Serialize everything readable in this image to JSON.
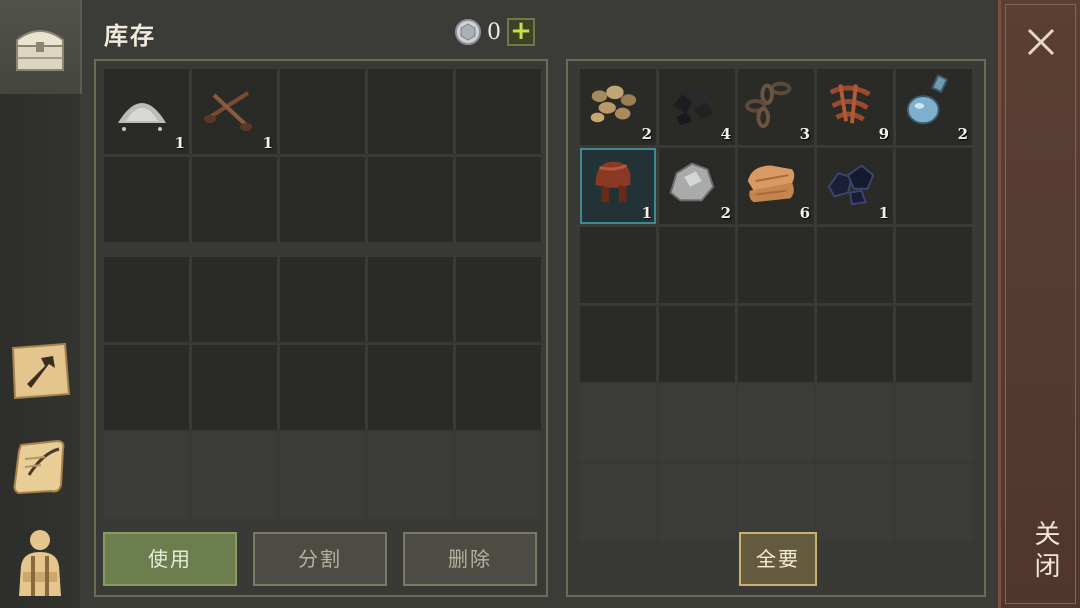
{
  "header": {
    "title": "库存",
    "currency_value": "0",
    "plus_label": "+"
  },
  "left_tabs": [
    {
      "name": "chest-icon",
      "active": true
    },
    {
      "name": "crafting-icon"
    },
    {
      "name": "scroll-icon"
    },
    {
      "name": "character-icon"
    }
  ],
  "inventory_top": {
    "items": [
      {
        "name": "stone-dust",
        "qty": "1"
      },
      {
        "name": "nails",
        "qty": "1"
      }
    ]
  },
  "storage": {
    "items": [
      {
        "name": "stones",
        "qty": "2"
      },
      {
        "name": "coal",
        "qty": "4"
      },
      {
        "name": "chain",
        "qty": "3"
      },
      {
        "name": "rusty-scrap",
        "qty": "9"
      },
      {
        "name": "glass-bottle",
        "qty": "2"
      },
      {
        "name": "saddle",
        "qty": "1"
      },
      {
        "name": "iron-ore",
        "qty": "2"
      },
      {
        "name": "leather",
        "qty": "6"
      },
      {
        "name": "dark-ore",
        "qty": "1"
      }
    ]
  },
  "buttons": {
    "use": "使用",
    "split": "分割",
    "delete": "删除",
    "take_all": "全要"
  },
  "close": {
    "label": "关闭"
  },
  "colors": {
    "accent_green": "#c5e04b",
    "close_bar": "#5b3f33"
  }
}
